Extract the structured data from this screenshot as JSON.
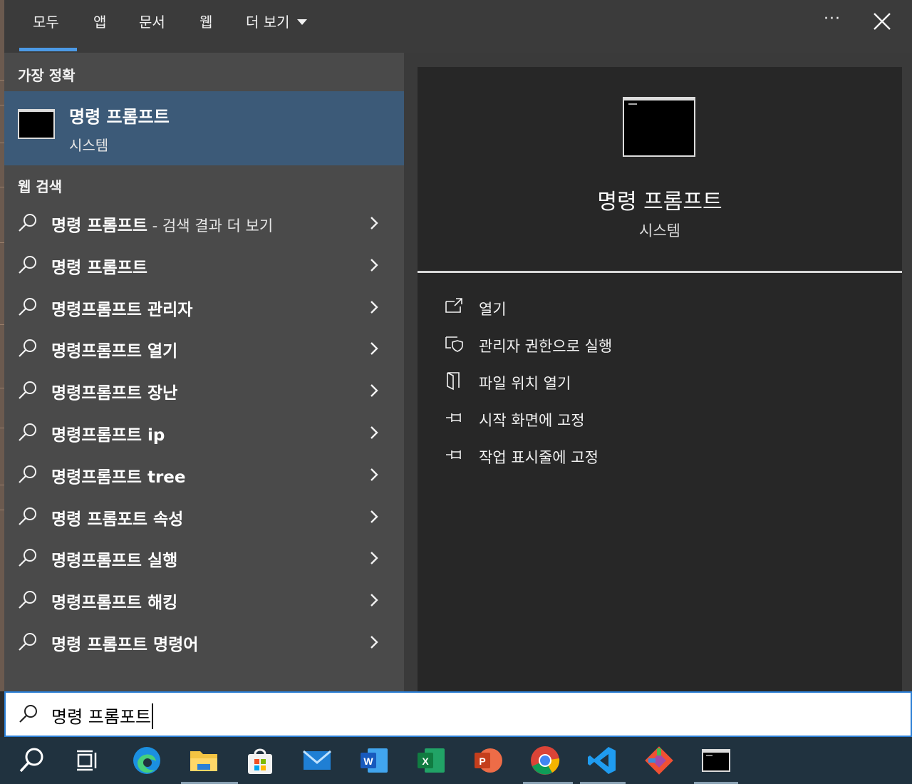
{
  "tabs": [
    {
      "label": "모두",
      "selected": true
    },
    {
      "label": "앱"
    },
    {
      "label": "문서"
    },
    {
      "label": "웹"
    },
    {
      "label": "더 보기"
    }
  ],
  "best_match": {
    "section_label": "가장 정확",
    "title": "명령 프롬프트",
    "subtitle": "시스템"
  },
  "web_search": {
    "section_label": "웹 검색",
    "items": [
      {
        "text": "명령 프롬프트",
        "suffix": " - 검색 결과 더 보기"
      },
      {
        "text": "명령 프롬프트",
        "suffix": ""
      },
      {
        "text": "명령프롬프트 관리자",
        "suffix": ""
      },
      {
        "text": "명령프롬프트 열기",
        "suffix": ""
      },
      {
        "text": "명령프롬프트 장난",
        "suffix": ""
      },
      {
        "text": "명령프롬프트 ip",
        "suffix": ""
      },
      {
        "text": "명령프롬프트 tree",
        "suffix": ""
      },
      {
        "text": "명령 프롬포트 속성",
        "suffix": ""
      },
      {
        "text": "명령프롬프트 실행",
        "suffix": ""
      },
      {
        "text": "명령프롬프트 해킹",
        "suffix": ""
      },
      {
        "text": "명령 프롬프트 명령어",
        "suffix": ""
      }
    ]
  },
  "detail": {
    "title": "명령 프롬프트",
    "subtitle": "시스템",
    "actions": [
      {
        "label": "열기",
        "icon": "open-icon"
      },
      {
        "label": "관리자 권한으로 실행",
        "icon": "shield-icon"
      },
      {
        "label": "파일 위치 열기",
        "icon": "file-location-icon"
      },
      {
        "label": "시작 화면에 고정",
        "icon": "pin-icon"
      },
      {
        "label": "작업 표시줄에 고정",
        "icon": "pin-icon"
      }
    ]
  },
  "search": {
    "value": "명령 프롬포트"
  },
  "taskbar": {
    "icons": [
      "search-icon",
      "task-view-icon",
      "edge-icon",
      "file-explorer-icon",
      "store-icon",
      "mail-icon",
      "word-icon",
      "excel-icon",
      "powerpoint-icon",
      "chrome-icon",
      "vscode-icon",
      "git-icon",
      "terminal-icon"
    ]
  },
  "colors": {
    "accent": "#4c9ae6",
    "selected_row": "#3c5a78",
    "taskbar": "#20323f"
  }
}
